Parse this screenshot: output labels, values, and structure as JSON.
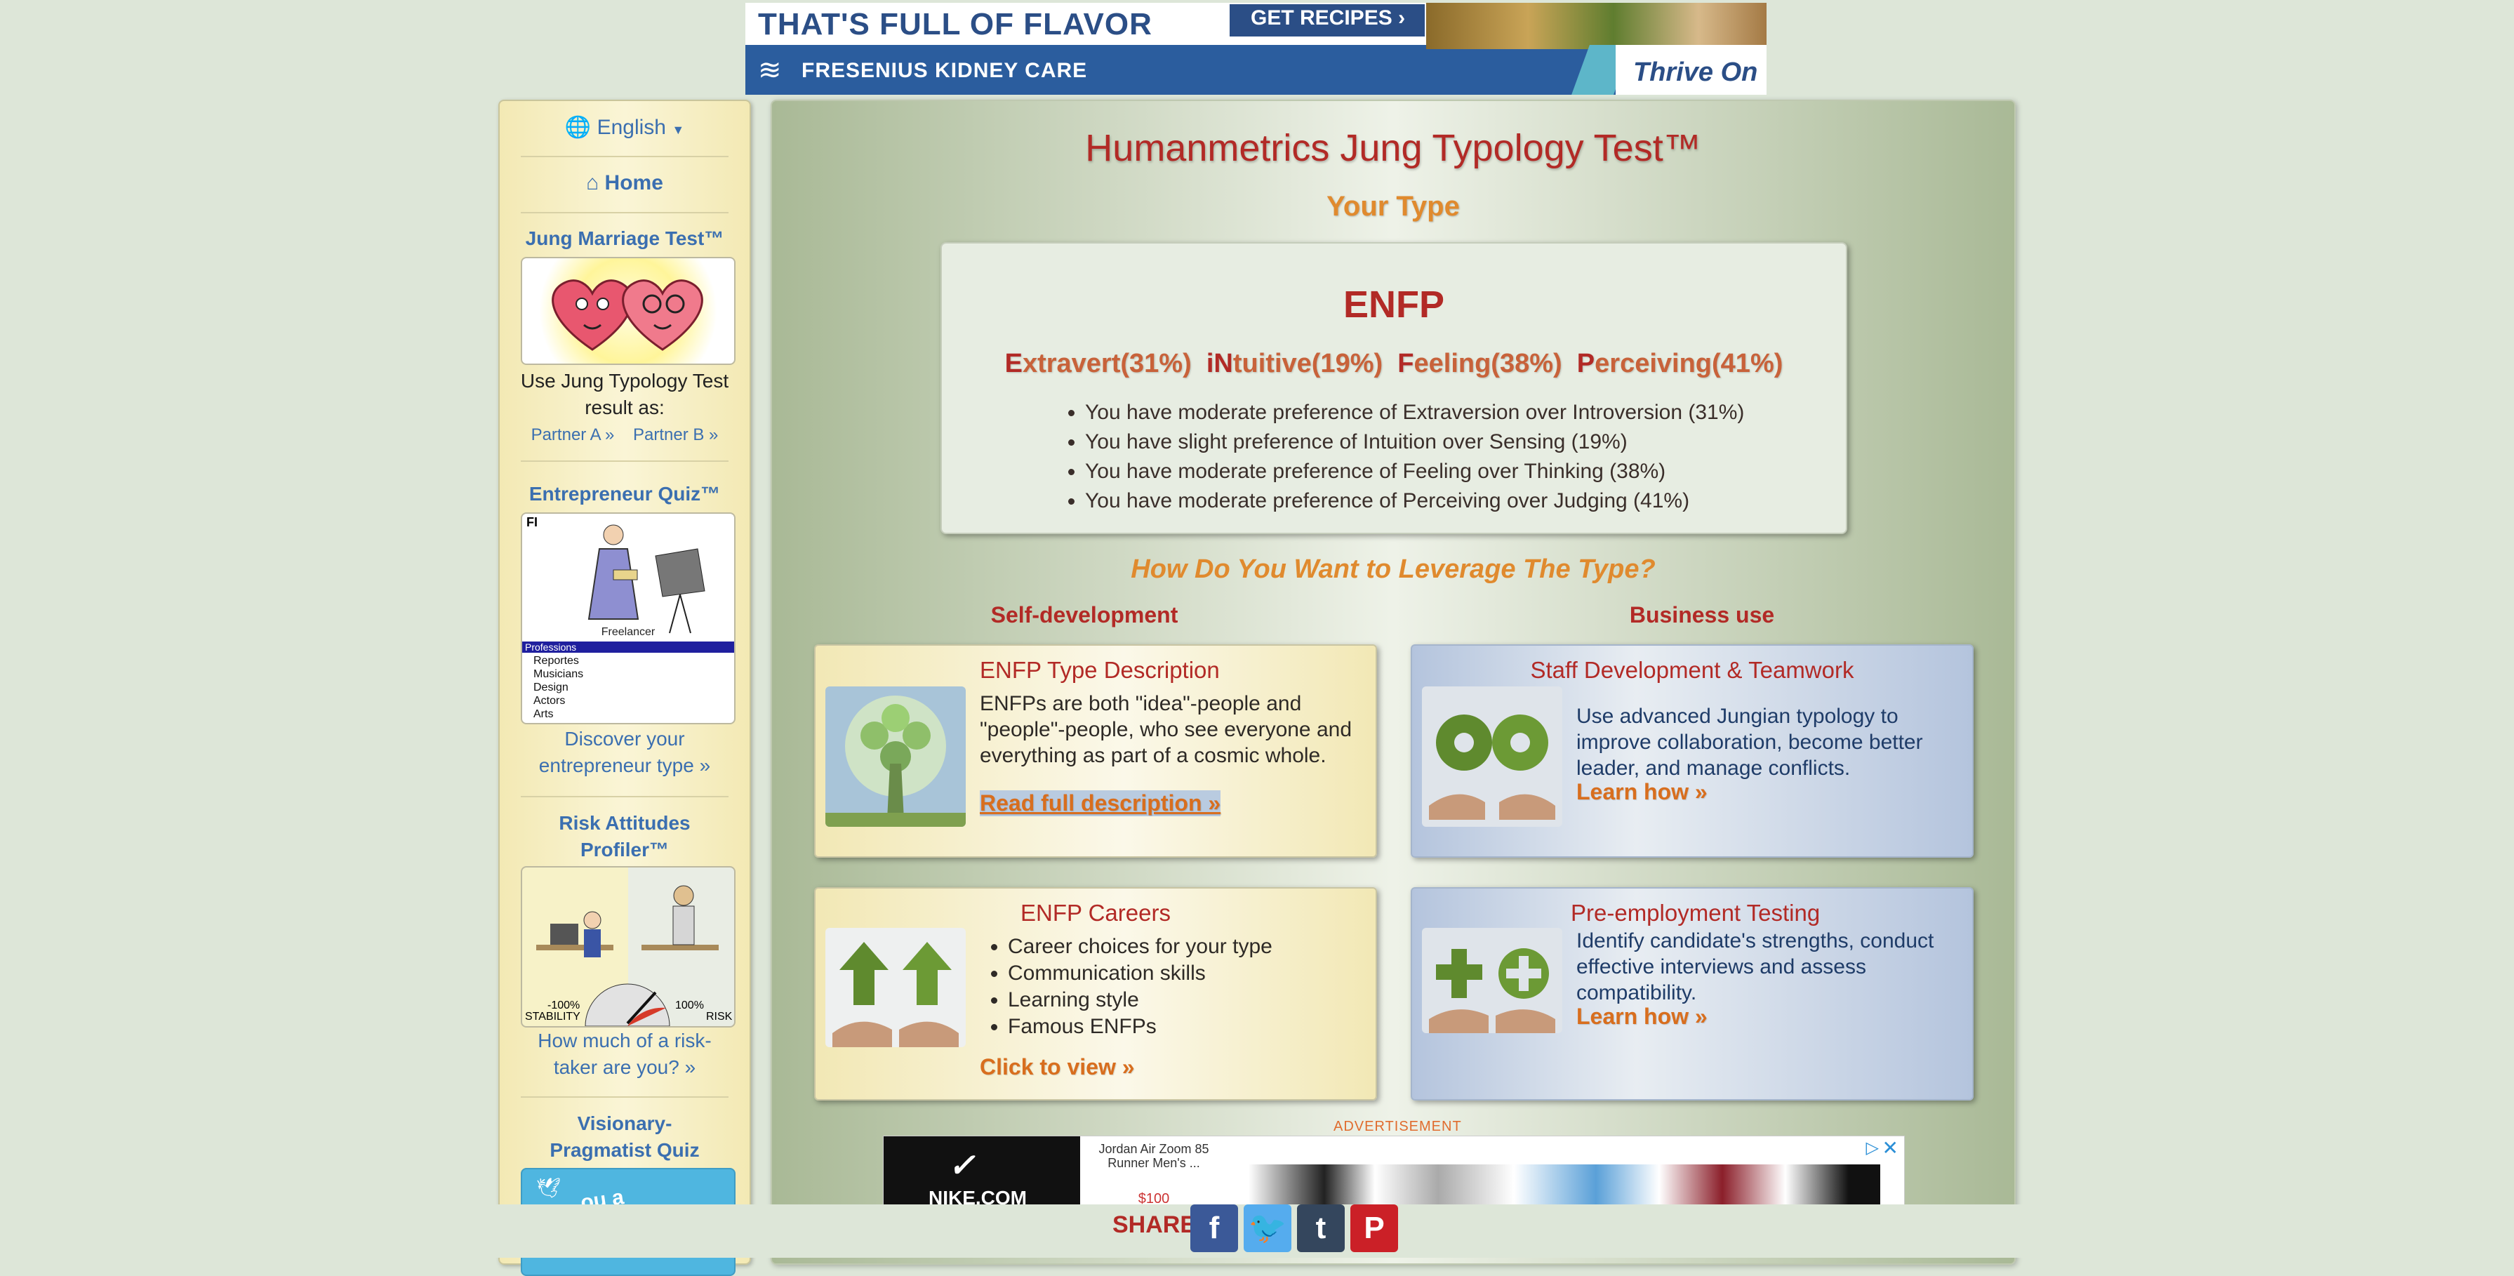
{
  "top_ad": {
    "headline": "THAT'S FULL OF FLAVOR",
    "cta": "GET RECIPES",
    "sponsor": "FRESENIUS KIDNEY CARE",
    "tagline": "Thrive On"
  },
  "sidebar": {
    "language": "English",
    "home": "Home",
    "marriage": {
      "title": "Jung Marriage Test™",
      "use_as": "Use Jung Typology Test result as:",
      "partner_a": "Partner A »",
      "partner_b": "Partner B »"
    },
    "entrepreneur": {
      "title": "Entrepreneur Quiz™",
      "figure_label": "Freelancer",
      "box_flag": "FI",
      "list_header": "Professions",
      "list_items": [
        "Reportes",
        "Musicians",
        "Design",
        "Actors",
        "Arts"
      ],
      "link": "Discover your entrepreneur type »"
    },
    "risk": {
      "title": "Risk Attitudes Profiler™",
      "gauge_left": "-100%",
      "gauge_left_label": "STABILITY",
      "gauge_right": "100%",
      "gauge_right_label": "RISK",
      "link": "How much of a risk-taker are you? »"
    },
    "visionary": {
      "title": "Visionary-Pragmatist Quiz",
      "thumb_text": "...ou a Visionary?"
    }
  },
  "main": {
    "title": "Humanmetrics Jung Typology Test™",
    "your_type": "Your Type",
    "type_code": "ENFP",
    "preferences": [
      {
        "letter": "E",
        "rest": "xtravert(31%)"
      },
      {
        "letter": "iN",
        "rest": "tuitive(19%)"
      },
      {
        "letter": "F",
        "rest": "eeling(38%)"
      },
      {
        "letter": "P",
        "rest": "erceiving(41%)"
      }
    ],
    "details": [
      "You have moderate preference of Extraversion over Introversion (31%)",
      "You have slight preference of Intuition over Sensing (19%)",
      "You have moderate preference of Feeling over Thinking (38%)",
      "You have moderate preference of Perceiving over Judging (41%)"
    ],
    "leverage_question": "How Do You Want to Leverage The Type?",
    "col_self": "Self-development",
    "col_business": "Business use",
    "card_desc": {
      "title": "ENFP Type Description",
      "text": "ENFPs are both \"idea\"-people and \"people\"-people, who see everyone and everything as part of a cosmic whole.",
      "link": "Read full description »"
    },
    "card_staff": {
      "title": "Staff Development & Teamwork",
      "text": "Use advanced Jungian typology to improve collaboration, become better leader, and manage conflicts.",
      "link": "Learn how »"
    },
    "card_careers": {
      "title": "ENFP Careers",
      "items": [
        "Career choices for your type",
        "Communication skills",
        "Learning style",
        "Famous ENFPs"
      ],
      "link": "Click to view »"
    },
    "card_preemp": {
      "title": "Pre-employment Testing",
      "text": "Identify candidate's strengths, conduct effective interviews and assess compatibility.",
      "link": "Learn how »"
    },
    "ad_label": "ADVERTISEMENT"
  },
  "bottom_ad": {
    "brand": "NIKE.COM",
    "product": "Jordan Air Zoom 85 Runner Men's ...",
    "price": "$100"
  },
  "share": {
    "label": "SHARE",
    "buttons": [
      {
        "name": "facebook",
        "glyph": "f",
        "color": "#3b5998"
      },
      {
        "name": "twitter",
        "glyph": "t",
        "color": "#55acee"
      },
      {
        "name": "tumblr",
        "glyph": "t",
        "color": "#34465d"
      },
      {
        "name": "pinterest",
        "glyph": "P",
        "color": "#cb2027"
      }
    ]
  }
}
